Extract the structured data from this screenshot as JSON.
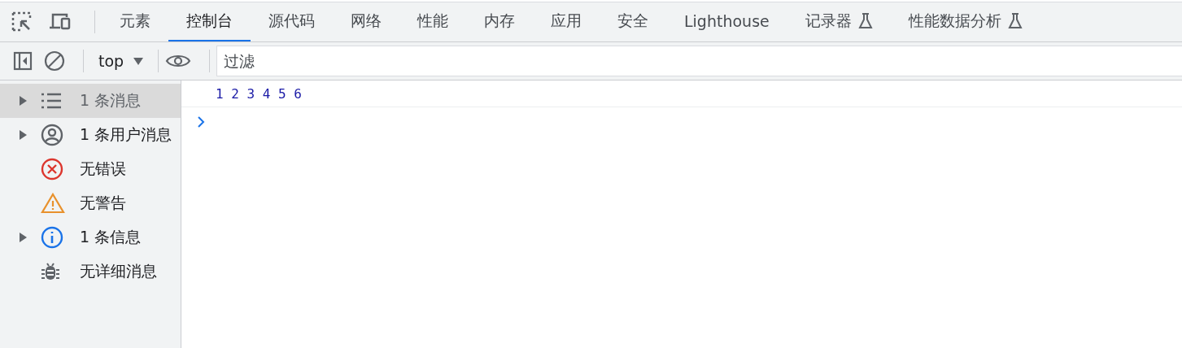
{
  "tabs": [
    {
      "label": "元素",
      "selected": false,
      "experimental": false
    },
    {
      "label": "控制台",
      "selected": true,
      "experimental": false
    },
    {
      "label": "源代码",
      "selected": false,
      "experimental": false
    },
    {
      "label": "网络",
      "selected": false,
      "experimental": false
    },
    {
      "label": "性能",
      "selected": false,
      "experimental": false
    },
    {
      "label": "内存",
      "selected": false,
      "experimental": false
    },
    {
      "label": "应用",
      "selected": false,
      "experimental": false
    },
    {
      "label": "安全",
      "selected": false,
      "experimental": false
    },
    {
      "label": "Lighthouse",
      "selected": false,
      "experimental": false
    },
    {
      "label": "记录器",
      "selected": false,
      "experimental": true
    },
    {
      "label": "性能数据分析",
      "selected": false,
      "experimental": true
    }
  ],
  "toolbar": {
    "context": "top",
    "filter": {
      "placeholder": "过滤"
    }
  },
  "sidebar": {
    "items": [
      {
        "kind": "messages",
        "label": "1 条消息",
        "expandable": true,
        "selected": true
      },
      {
        "kind": "user",
        "label": "1 条用户消息",
        "expandable": true,
        "selected": false
      },
      {
        "kind": "error",
        "label": "无错误",
        "expandable": false,
        "selected": false
      },
      {
        "kind": "warning",
        "label": "无警告",
        "expandable": false,
        "selected": false
      },
      {
        "kind": "info",
        "label": "1 条信息",
        "expandable": true,
        "selected": false
      },
      {
        "kind": "verbose",
        "label": "无详细消息",
        "expandable": false,
        "selected": false
      }
    ]
  },
  "console": {
    "lines": [
      "1 2 3 4 5 6"
    ]
  }
}
